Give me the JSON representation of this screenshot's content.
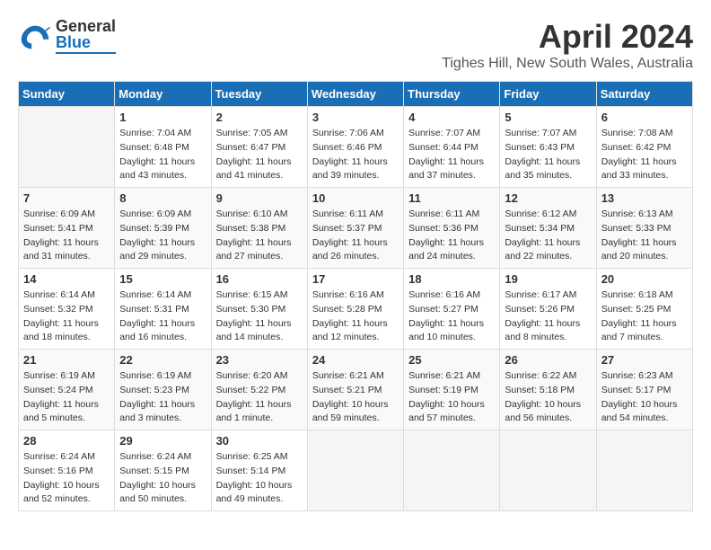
{
  "header": {
    "logo": {
      "general": "General",
      "blue": "Blue"
    },
    "title": "April 2024",
    "location": "Tighes Hill, New South Wales, Australia"
  },
  "calendar": {
    "days_of_week": [
      "Sunday",
      "Monday",
      "Tuesday",
      "Wednesday",
      "Thursday",
      "Friday",
      "Saturday"
    ],
    "weeks": [
      [
        {
          "day": "",
          "info": ""
        },
        {
          "day": "1",
          "info": "Sunrise: 7:04 AM\nSunset: 6:48 PM\nDaylight: 11 hours\nand 43 minutes."
        },
        {
          "day": "2",
          "info": "Sunrise: 7:05 AM\nSunset: 6:47 PM\nDaylight: 11 hours\nand 41 minutes."
        },
        {
          "day": "3",
          "info": "Sunrise: 7:06 AM\nSunset: 6:46 PM\nDaylight: 11 hours\nand 39 minutes."
        },
        {
          "day": "4",
          "info": "Sunrise: 7:07 AM\nSunset: 6:44 PM\nDaylight: 11 hours\nand 37 minutes."
        },
        {
          "day": "5",
          "info": "Sunrise: 7:07 AM\nSunset: 6:43 PM\nDaylight: 11 hours\nand 35 minutes."
        },
        {
          "day": "6",
          "info": "Sunrise: 7:08 AM\nSunset: 6:42 PM\nDaylight: 11 hours\nand 33 minutes."
        }
      ],
      [
        {
          "day": "7",
          "info": "Sunrise: 6:09 AM\nSunset: 5:41 PM\nDaylight: 11 hours\nand 31 minutes."
        },
        {
          "day": "8",
          "info": "Sunrise: 6:09 AM\nSunset: 5:39 PM\nDaylight: 11 hours\nand 29 minutes."
        },
        {
          "day": "9",
          "info": "Sunrise: 6:10 AM\nSunset: 5:38 PM\nDaylight: 11 hours\nand 27 minutes."
        },
        {
          "day": "10",
          "info": "Sunrise: 6:11 AM\nSunset: 5:37 PM\nDaylight: 11 hours\nand 26 minutes."
        },
        {
          "day": "11",
          "info": "Sunrise: 6:11 AM\nSunset: 5:36 PM\nDaylight: 11 hours\nand 24 minutes."
        },
        {
          "day": "12",
          "info": "Sunrise: 6:12 AM\nSunset: 5:34 PM\nDaylight: 11 hours\nand 22 minutes."
        },
        {
          "day": "13",
          "info": "Sunrise: 6:13 AM\nSunset: 5:33 PM\nDaylight: 11 hours\nand 20 minutes."
        }
      ],
      [
        {
          "day": "14",
          "info": "Sunrise: 6:14 AM\nSunset: 5:32 PM\nDaylight: 11 hours\nand 18 minutes."
        },
        {
          "day": "15",
          "info": "Sunrise: 6:14 AM\nSunset: 5:31 PM\nDaylight: 11 hours\nand 16 minutes."
        },
        {
          "day": "16",
          "info": "Sunrise: 6:15 AM\nSunset: 5:30 PM\nDaylight: 11 hours\nand 14 minutes."
        },
        {
          "day": "17",
          "info": "Sunrise: 6:16 AM\nSunset: 5:28 PM\nDaylight: 11 hours\nand 12 minutes."
        },
        {
          "day": "18",
          "info": "Sunrise: 6:16 AM\nSunset: 5:27 PM\nDaylight: 11 hours\nand 10 minutes."
        },
        {
          "day": "19",
          "info": "Sunrise: 6:17 AM\nSunset: 5:26 PM\nDaylight: 11 hours\nand 8 minutes."
        },
        {
          "day": "20",
          "info": "Sunrise: 6:18 AM\nSunset: 5:25 PM\nDaylight: 11 hours\nand 7 minutes."
        }
      ],
      [
        {
          "day": "21",
          "info": "Sunrise: 6:19 AM\nSunset: 5:24 PM\nDaylight: 11 hours\nand 5 minutes."
        },
        {
          "day": "22",
          "info": "Sunrise: 6:19 AM\nSunset: 5:23 PM\nDaylight: 11 hours\nand 3 minutes."
        },
        {
          "day": "23",
          "info": "Sunrise: 6:20 AM\nSunset: 5:22 PM\nDaylight: 11 hours\nand 1 minute."
        },
        {
          "day": "24",
          "info": "Sunrise: 6:21 AM\nSunset: 5:21 PM\nDaylight: 10 hours\nand 59 minutes."
        },
        {
          "day": "25",
          "info": "Sunrise: 6:21 AM\nSunset: 5:19 PM\nDaylight: 10 hours\nand 57 minutes."
        },
        {
          "day": "26",
          "info": "Sunrise: 6:22 AM\nSunset: 5:18 PM\nDaylight: 10 hours\nand 56 minutes."
        },
        {
          "day": "27",
          "info": "Sunrise: 6:23 AM\nSunset: 5:17 PM\nDaylight: 10 hours\nand 54 minutes."
        }
      ],
      [
        {
          "day": "28",
          "info": "Sunrise: 6:24 AM\nSunset: 5:16 PM\nDaylight: 10 hours\nand 52 minutes."
        },
        {
          "day": "29",
          "info": "Sunrise: 6:24 AM\nSunset: 5:15 PM\nDaylight: 10 hours\nand 50 minutes."
        },
        {
          "day": "30",
          "info": "Sunrise: 6:25 AM\nSunset: 5:14 PM\nDaylight: 10 hours\nand 49 minutes."
        },
        {
          "day": "",
          "info": ""
        },
        {
          "day": "",
          "info": ""
        },
        {
          "day": "",
          "info": ""
        },
        {
          "day": "",
          "info": ""
        }
      ]
    ]
  }
}
